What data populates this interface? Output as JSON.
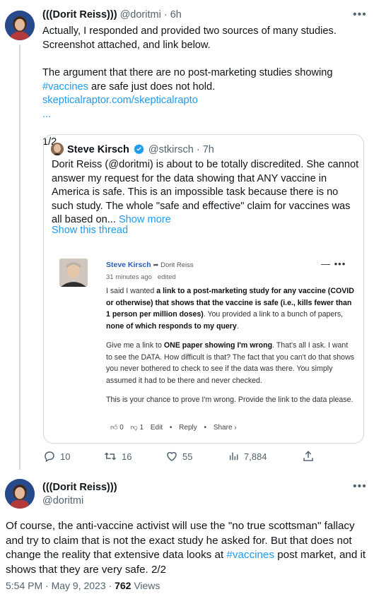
{
  "tweet1": {
    "display_name": "(((Dorit Reiss)))",
    "handle": "@doritmi",
    "time": "6h",
    "text_p1": "Actually, I responded and provided two sources of many studies. Screenshot attached, and link below.",
    "text_p2_a": "The argument that there are no post-marketing studies showing",
    "hashtag": "#vaccines",
    "text_p2_b": "are safe just does not hold.",
    "link": "skepticalraptor.com/skepticalrapto",
    "link_ellipsis": "...",
    "counter": "1/2"
  },
  "quote": {
    "display_name": "Steve Kirsch",
    "handle": "@stkirsch",
    "time": "7h",
    "text": "Dorit Reiss (@doritmi)  is about to be totally discredited. She cannot answer my request for the data showing that ANY vaccine in America is safe. This is an impossible task because there is no such study. The whole \"safe and effective\" claim for vaccines was all based on...",
    "show_more": "Show more",
    "show_thread": "Show this thread",
    "verified_color": "#1d9bf0"
  },
  "screenshot": {
    "name": "Steve Kirsch",
    "reply_to": "Dorit Reiss",
    "time": "31 minutes ago",
    "edited": "edited",
    "menu": "—  •••",
    "p1_a": "I said I wanted ",
    "p1_b": "a link to a post-marketing study for any vaccine (COVID or otherwise) that shows that the vaccine is safe (i.e., kills fewer than 1 person per million doses)",
    "p1_c": ". You provided a link to a bunch of papers, ",
    "p1_d": "none of which responds to my query",
    "p1_e": ".",
    "p2_a": "Give me a link to ",
    "p2_b": "ONE paper showing I'm wrong",
    "p2_c": ". That's all I ask. I want to see the DATA. How difficult is that? The fact that you can't do that shows you never bothered to check to see if the data was there. You simply assumed it had to be there and never checked.",
    "p3": "This is your chance to prove I'm wrong. Provide the link to the data please.",
    "likes": "0",
    "dislikes": "1",
    "edit": "Edit",
    "reply": "Reply",
    "share": "Share ›",
    "link_color": "#2a5db0"
  },
  "metrics": {
    "replies": "10",
    "retweets": "16",
    "likes": "55",
    "views": "7,884"
  },
  "tweet2": {
    "display_name": "(((Dorit Reiss)))",
    "handle": "@doritmi",
    "text_a": "Of course, the anti-vaccine activist will use the \"no true scottsman\" fallacy and try to claim that is not the exact study he asked for. But that does not change the reality that extensive data looks at",
    "hashtag": "#vaccines",
    "text_b": "post market, and it shows that they are very safe. 2/2",
    "timestamp": "5:54 PM · May 9, 2023 · ",
    "views_count": "762",
    "views_label": " Views"
  },
  "colors": {
    "accent": "#1d9bf0",
    "secondary_text": "#536471",
    "border": "#cfd9de"
  }
}
